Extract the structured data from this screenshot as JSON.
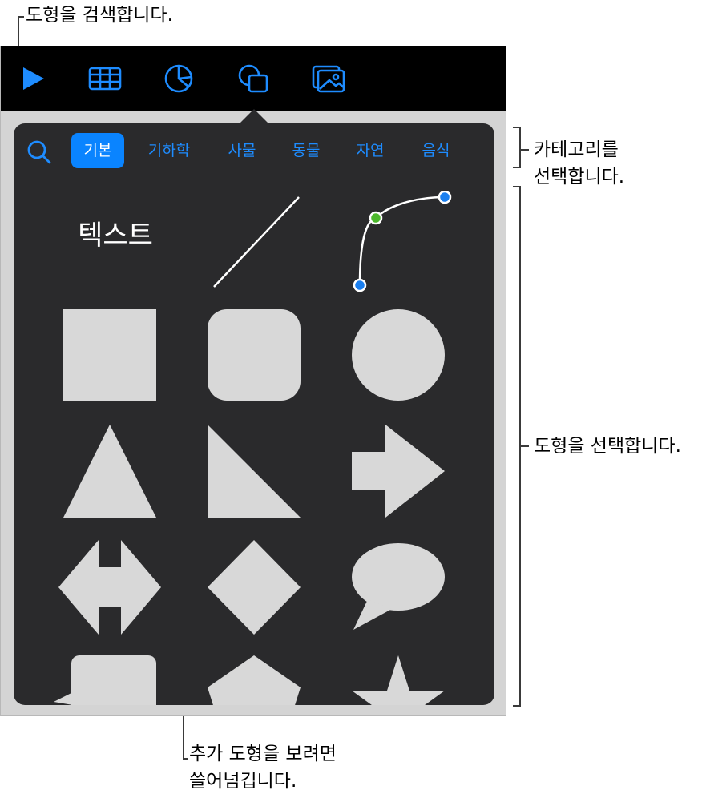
{
  "annotations": {
    "search_shapes": "도형을 검색합니다.",
    "choose_category_line1": "카테고리를",
    "choose_category_line2": "선택합니다.",
    "choose_shape": "도형을 선택합니다.",
    "swipe_line1": "추가 도형을 보려면",
    "swipe_line2": "쓸어넘깁니다."
  },
  "toolbar": {
    "buttons": [
      {
        "name": "play-icon"
      },
      {
        "name": "table-icon"
      },
      {
        "name": "chart-icon"
      },
      {
        "name": "shape-icon",
        "selected": true
      },
      {
        "name": "media-icon"
      }
    ]
  },
  "popover": {
    "search_icon": "search-icon",
    "tabs": [
      {
        "label": "기본",
        "active": true
      },
      {
        "label": "기하학"
      },
      {
        "label": "사물"
      },
      {
        "label": "동물"
      },
      {
        "label": "자연"
      },
      {
        "label": "음식"
      }
    ],
    "text_shape_label": "텍스트",
    "shapes": [
      "line",
      "curve",
      "square",
      "rounded-square",
      "circle",
      "triangle",
      "right-triangle",
      "arrow",
      "double-arrow",
      "diamond",
      "speech-bubble",
      "callout",
      "pentagon",
      "star"
    ]
  },
  "colors": {
    "accent": "#0a84ff",
    "shape_fill": "#d8d8d8",
    "popover_bg": "#2a2a2c",
    "curve_mid_point": "#4cb82c"
  }
}
